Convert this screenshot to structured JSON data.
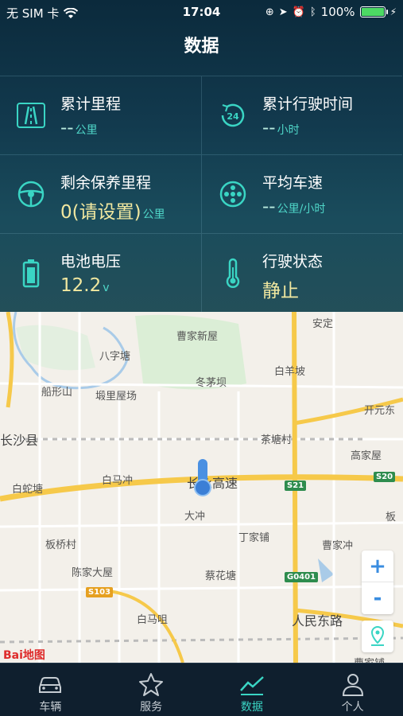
{
  "status_bar": {
    "carrier": "无 SIM 卡",
    "time": "17:04",
    "battery": "100%"
  },
  "header": {
    "title": "数据"
  },
  "stats": [
    {
      "label": "累计里程",
      "value": "--",
      "unit": "公里",
      "icon": "road-icon"
    },
    {
      "label": "累计行驶时间",
      "value": "--",
      "unit": "小时",
      "icon": "clock-24-icon"
    },
    {
      "label": "剩余保养里程",
      "value": "0(请设置)",
      "unit": "公里",
      "icon": "steering-wheel-icon"
    },
    {
      "label": "平均车速",
      "value": "--",
      "unit": "公里/小时",
      "icon": "wheel-icon"
    },
    {
      "label": "电池电压",
      "value": "12.2",
      "unit": "v",
      "icon": "battery-icon"
    },
    {
      "label": "行驶状态",
      "value": "静止",
      "unit": "",
      "icon": "thermometer-icon"
    }
  ],
  "map": {
    "labels": [
      "曹家新屋",
      "安定",
      "八字塘",
      "白羊坡",
      "冬茅坝",
      "船形山",
      "塅里屋场",
      "开元东",
      "长沙县",
      "茶塘村",
      "高家屋",
      "白蛇塘",
      "白马冲",
      "长永高速",
      "大冲",
      "板",
      "丁家铺",
      "曹家冲",
      "板桥村",
      "蔡花塘",
      "陈家大屋",
      "白马咀",
      "人民东路",
      "曹家铺"
    ],
    "road_shields": [
      "S21",
      "S20",
      "G0401",
      "S103"
    ],
    "zoom_in": "+",
    "zoom_out": "-",
    "logo": "Bai地图"
  },
  "tabs": [
    {
      "label": "车辆",
      "icon": "car-icon"
    },
    {
      "label": "服务",
      "icon": "star-icon"
    },
    {
      "label": "数据",
      "icon": "chart-icon",
      "active": true
    },
    {
      "label": "个人",
      "icon": "person-icon"
    }
  ],
  "colors": {
    "accent": "#3ad5c4",
    "value": "#f1e8a0"
  }
}
